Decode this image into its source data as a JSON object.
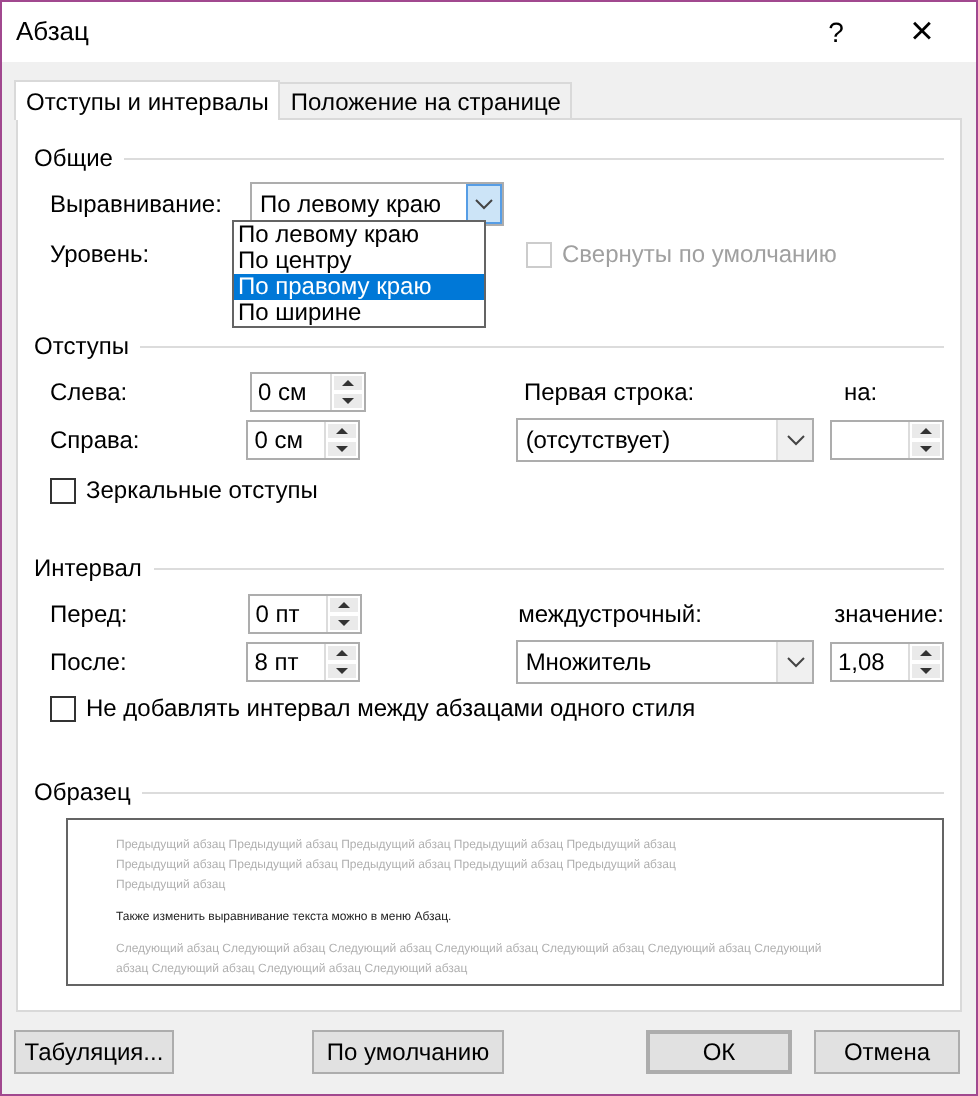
{
  "window": {
    "title": "Абзац",
    "help": "?",
    "close": "×"
  },
  "tabs": [
    {
      "label": "Отступы и интервалы",
      "selected": true
    },
    {
      "label": "Положение на странице",
      "selected": false
    }
  ],
  "general": {
    "title": "Общие",
    "alignment": {
      "label": "Выравнивание:",
      "value": "По левому краю",
      "expanded": true,
      "options": [
        {
          "label": "По левому краю",
          "highlighted": false
        },
        {
          "label": "По центру",
          "highlighted": false
        },
        {
          "label": "По правому краю",
          "highlighted": true
        },
        {
          "label": "По ширине",
          "highlighted": false
        }
      ]
    },
    "level": {
      "label": "Уровень:"
    },
    "collapsed": {
      "label": "Свернуты по умолчанию",
      "checked": false,
      "disabled": true
    }
  },
  "indents": {
    "title": "Отступы",
    "left": {
      "label": "Слева:",
      "value": "0 см"
    },
    "right": {
      "label": "Справа:",
      "value": "0 см"
    },
    "first_line": {
      "label": "Первая строка:",
      "value": "(отсутствует)"
    },
    "by": {
      "label": "на:"
    },
    "mirror": {
      "label": "Зеркальные отступы",
      "checked": false,
      "disabled": false
    }
  },
  "spacing": {
    "title": "Интервал",
    "before": {
      "label": "Перед:",
      "value": "0 пт"
    },
    "after": {
      "label": "После:",
      "value": "8 пт"
    },
    "line_spacing": {
      "label": "междустрочный:",
      "value": "Множитель"
    },
    "at": {
      "label": "значение:",
      "value": "1,08"
    },
    "no_space": {
      "label": "Не добавлять интервал между абзацами одного стиля",
      "checked": false,
      "disabled": false
    }
  },
  "preview": {
    "title": "Образец",
    "previous": "Предыдущий абзац Предыдущий абзац Предыдущий абзац Предыдущий абзац Предыдущий абзац Предыдущий абзац Предыдущий абзац Предыдущий абзац Предыдущий абзац Предыдущий абзац Предыдущий абзац",
    "sample": "Также изменить выравнивание текста можно в меню Абзац.",
    "next": "Следующий абзац Следующий абзац Следующий абзац Следующий абзац Следующий абзац Следующий абзац Следующий абзац Следующий абзац Следующий абзац Следующий абзац"
  },
  "buttons": [
    {
      "label": "Табуляция...",
      "kind": "left"
    },
    {
      "label": "По умолчанию",
      "kind": "center"
    },
    {
      "label": "ОК",
      "kind": "default"
    },
    {
      "label": "Отмена",
      "kind": "normal"
    }
  ]
}
